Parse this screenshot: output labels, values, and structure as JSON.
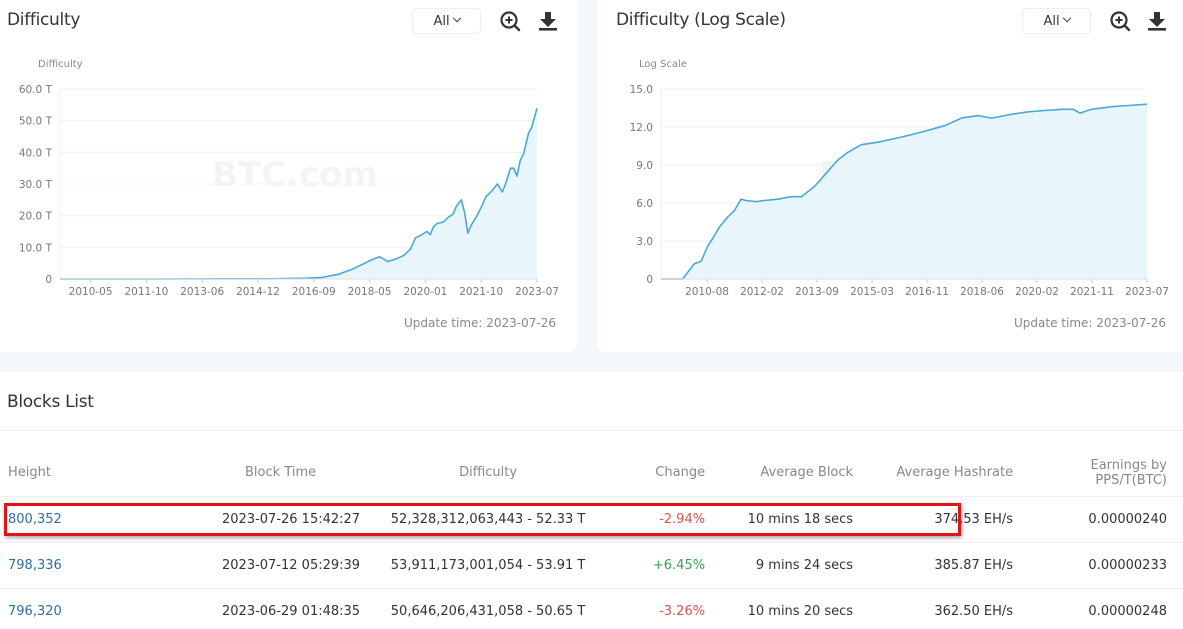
{
  "left_panel": {
    "title": "Difficulty",
    "range_select": "All",
    "zoom_icon": "zoom-in-icon",
    "download_icon": "download-icon",
    "update_time": "Update time: 2023-07-26"
  },
  "right_panel": {
    "title": "Difficulty (Log Scale)",
    "range_select": "All",
    "zoom_icon": "zoom-in-icon",
    "download_icon": "download-icon",
    "update_time": "Update time: 2023-07-26"
  },
  "watermark": "BTC.com",
  "colors": {
    "line": "#4aa8d8",
    "area": "#e8f6fb",
    "negative": "#d9534f",
    "positive": "#3a9d5d",
    "link": "#2c6ea3",
    "highlight": "#e0141b"
  },
  "chart_data": [
    {
      "type": "area",
      "title": "Difficulty",
      "ylabel": "Difficulty",
      "xlabel": "",
      "ylim": [
        0,
        60
      ],
      "y_unit": "T",
      "y_ticks": [
        "0",
        "10.0 T",
        "20.0 T",
        "30.0 T",
        "40.0 T",
        "50.0 T",
        "60.0 T"
      ],
      "x_ticks": [
        "2010-05",
        "2011-10",
        "2013-06",
        "2014-12",
        "2016-09",
        "2018-05",
        "2020-01",
        "2021-10",
        "2023-07"
      ],
      "x_range": [
        2009.0,
        2023.56
      ],
      "grid": true,
      "legend": "none",
      "series": [
        {
          "name": "Difficulty",
          "x": [
            2009.0,
            2012.0,
            2014.0,
            2015.5,
            2016.5,
            2017.0,
            2017.5,
            2017.9,
            2018.2,
            2018.5,
            2018.75,
            2018.9,
            2019.0,
            2019.3,
            2019.5,
            2019.7,
            2019.85,
            2020.0,
            2020.2,
            2020.3,
            2020.4,
            2020.5,
            2020.7,
            2020.85,
            2021.0,
            2021.1,
            2021.25,
            2021.35,
            2021.45,
            2021.55,
            2021.7,
            2021.85,
            2022.0,
            2022.2,
            2022.35,
            2022.5,
            2022.6,
            2022.75,
            2022.85,
            2022.95,
            2023.05,
            2023.15,
            2023.3,
            2023.4,
            2023.48,
            2023.56
          ],
          "values": [
            0,
            0.002,
            0.05,
            0.07,
            0.25,
            0.5,
            1.5,
            3.0,
            4.5,
            6.0,
            7.0,
            6.2,
            5.5,
            6.5,
            7.5,
            9.5,
            13.0,
            13.7,
            15.0,
            14.0,
            16.5,
            17.5,
            18.0,
            19.5,
            20.5,
            23.0,
            25.0,
            21.0,
            14.5,
            17.0,
            19.5,
            22.5,
            26.0,
            28.0,
            30.0,
            27.5,
            30.0,
            35.0,
            35.0,
            32.5,
            37.5,
            39.5,
            46.0,
            48.0,
            51.0,
            53.9
          ]
        }
      ]
    },
    {
      "type": "area",
      "title": "Difficulty (Log Scale)",
      "ylabel": "Log Scale",
      "xlabel": "",
      "ylim": [
        0,
        15
      ],
      "y_ticks": [
        "0",
        "3.0",
        "6.0",
        "9.0",
        "12.0",
        "15.0"
      ],
      "x_ticks": [
        "2010-08",
        "2012-02",
        "2013-09",
        "2015-03",
        "2016-11",
        "2018-06",
        "2020-02",
        "2021-11",
        "2023-07"
      ],
      "x_range": [
        2009.0,
        2023.56
      ],
      "grid": true,
      "legend": "none",
      "series": [
        {
          "name": "Log Scale",
          "x": [
            2009.0,
            2009.65,
            2009.85,
            2010.0,
            2010.2,
            2010.4,
            2010.55,
            2010.75,
            2011.0,
            2011.2,
            2011.4,
            2011.55,
            2011.85,
            2012.1,
            2012.5,
            2012.9,
            2013.2,
            2013.6,
            2014.0,
            2014.3,
            2014.6,
            2015.0,
            2015.5,
            2016.2,
            2016.8,
            2017.5,
            2018.0,
            2018.5,
            2018.9,
            2019.5,
            2020.0,
            2020.5,
            2021.0,
            2021.35,
            2021.55,
            2021.9,
            2022.5,
            2023.0,
            2023.56
          ],
          "values": [
            0,
            0,
            0.7,
            1.2,
            1.4,
            2.6,
            3.2,
            4.1,
            4.9,
            5.4,
            6.3,
            6.2,
            6.1,
            6.2,
            6.3,
            6.5,
            6.5,
            7.3,
            8.5,
            9.4,
            10.0,
            10.6,
            10.8,
            11.2,
            11.6,
            12.1,
            12.7,
            12.9,
            12.7,
            13.0,
            13.2,
            13.3,
            13.4,
            13.4,
            13.1,
            13.4,
            13.6,
            13.7,
            13.8
          ]
        }
      ]
    }
  ],
  "blocks_list": {
    "title": "Blocks List",
    "columns": [
      "Height",
      "Block Time",
      "Difficulty",
      "Change",
      "Average Block",
      "Average Hashrate",
      "Earnings by PPS/T(BTC)"
    ],
    "rows": [
      {
        "height": "800,352",
        "block_time": "2023-07-26 15:42:27",
        "difficulty": "52,328,312,063,443 - 52.33 T",
        "change": "-2.94%",
        "change_dir": "neg",
        "avg_block": "10 mins 18 secs",
        "avg_hashrate": "374.53 EH/s",
        "earnings": "0.00000240",
        "highlighted": true
      },
      {
        "height": "798,336",
        "block_time": "2023-07-12 05:29:39",
        "difficulty": "53,911,173,001,054 - 53.91 T",
        "change": "+6.45%",
        "change_dir": "pos",
        "avg_block": "9 mins 24 secs",
        "avg_hashrate": "385.87 EH/s",
        "earnings": "0.00000233",
        "highlighted": false
      },
      {
        "height": "796,320",
        "block_time": "2023-06-29 01:48:35",
        "difficulty": "50,646,206,431,058 - 50.65 T",
        "change": "-3.26%",
        "change_dir": "neg",
        "avg_block": "10 mins 20 secs",
        "avg_hashrate": "362.50 EH/s",
        "earnings": "0.00000248",
        "highlighted": false
      }
    ]
  }
}
